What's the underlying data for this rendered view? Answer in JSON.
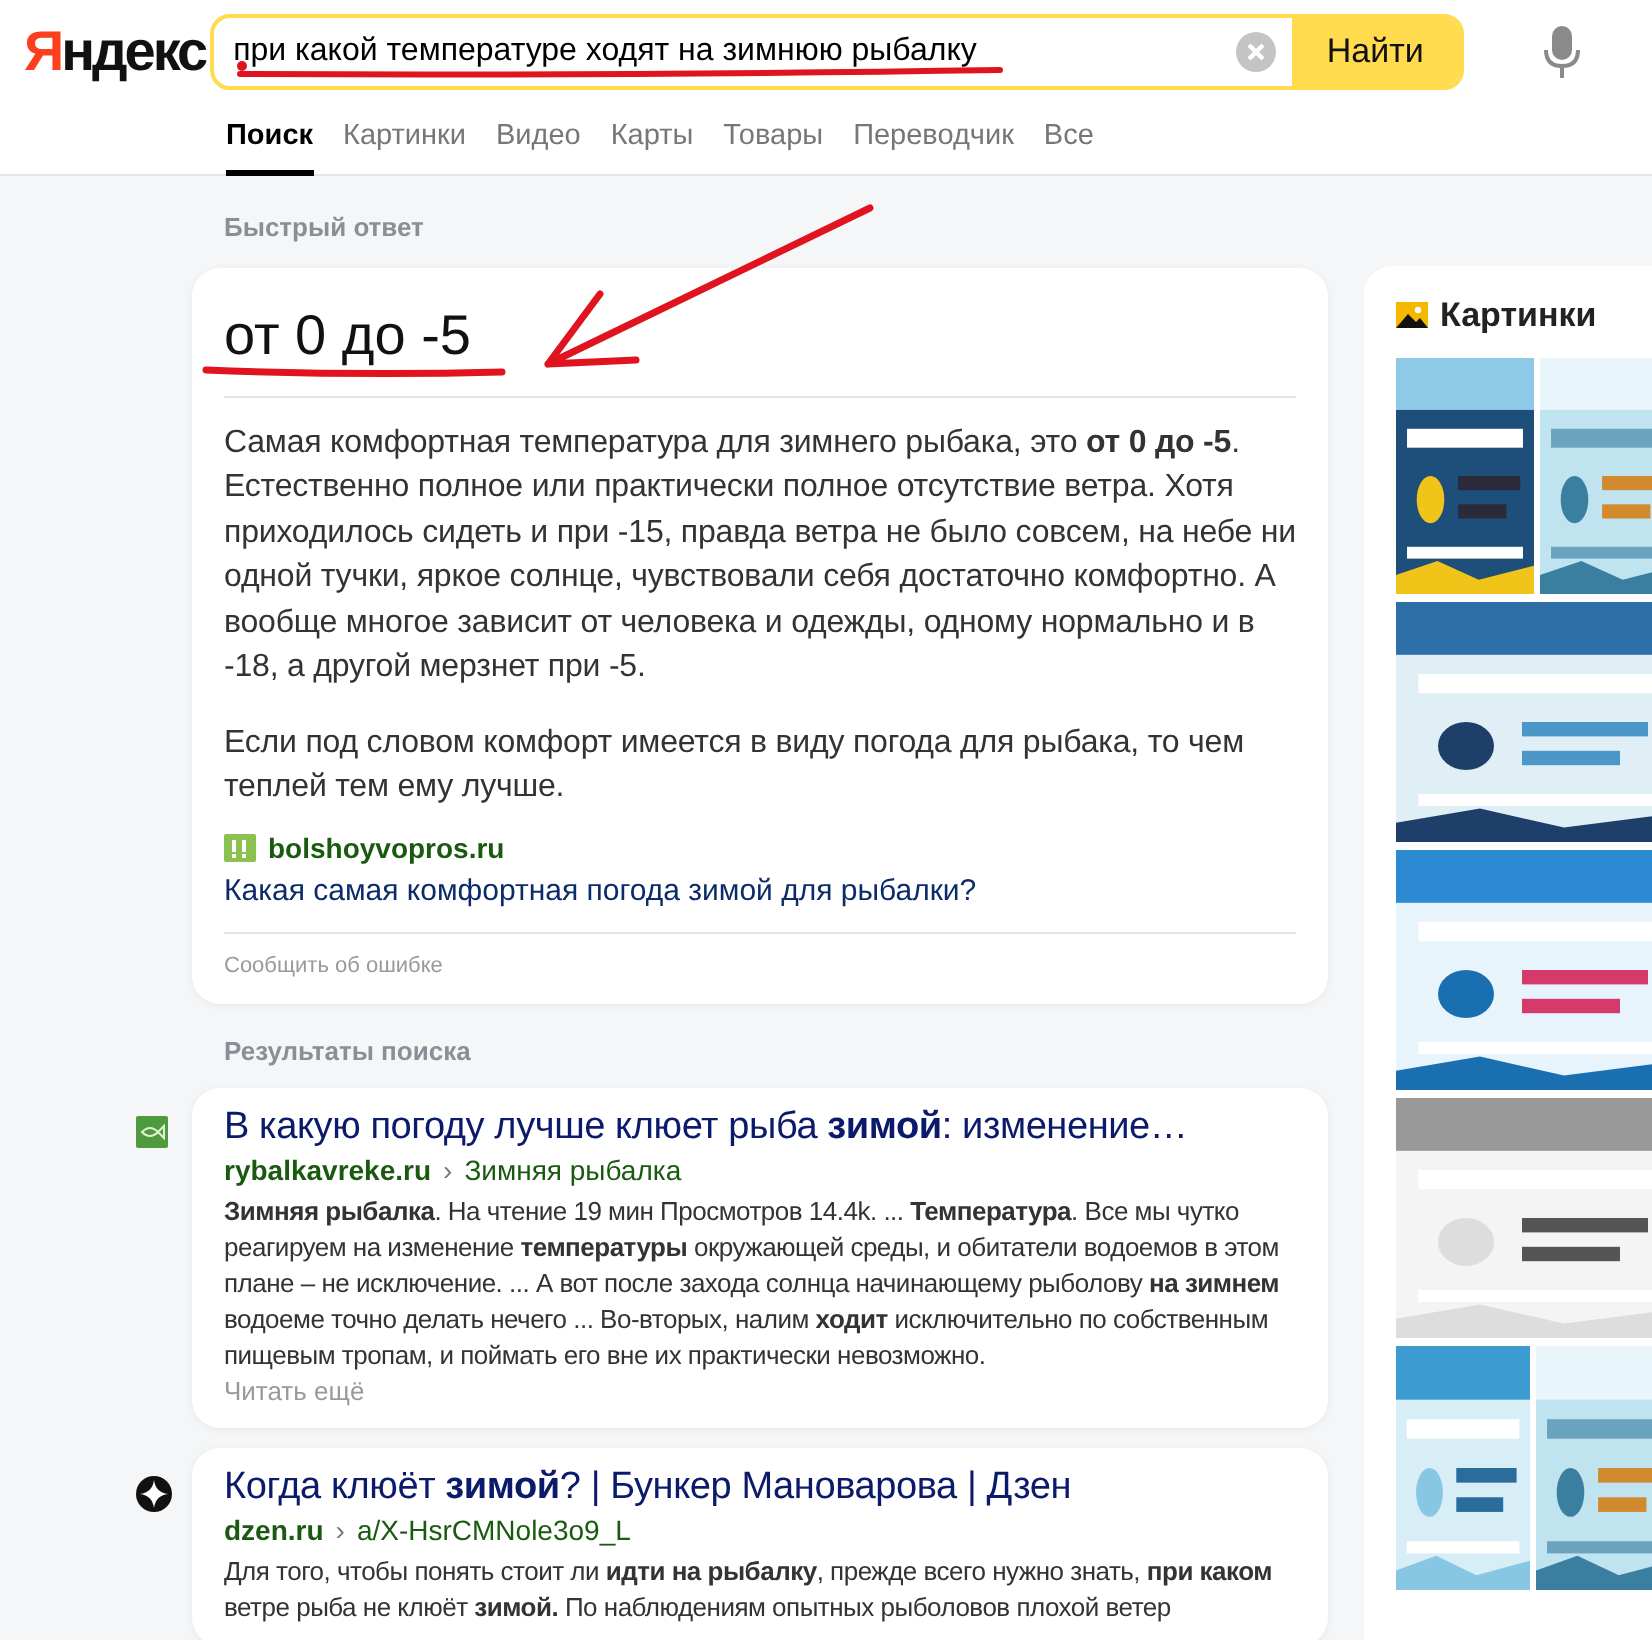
{
  "header": {
    "logo": {
      "first": "Я",
      "rest": "ндекс"
    },
    "search": {
      "value": "при какой температуре ходят на зимнюю рыбалку"
    },
    "search_button": "Найти"
  },
  "tabs": [
    {
      "label": "Поиск",
      "selected": true
    },
    {
      "label": "Картинки",
      "selected": false
    },
    {
      "label": "Видео",
      "selected": false
    },
    {
      "label": "Карты",
      "selected": false
    },
    {
      "label": "Товары",
      "selected": false
    },
    {
      "label": "Переводчик",
      "selected": false
    },
    {
      "label": "Все",
      "selected": false
    }
  ],
  "quick_answer": {
    "label": "Быстрый ответ",
    "title": "от 0 до -5",
    "paragraphs": [
      "Самая комфортная температура для зимнего рыбака, это **от 0 до -5**. Естественно полное или практически полное отсутствие ветра. Хотя приходилось сидеть и при -15, правда ветра не было совсем, на небе ни одной тучки, яркое солнце, чувствовали себя достаточно комфортно. А вообще многое зависит от человека и одежды, одному нормально и в -18, а другой мерзнет при -5.",
      "Если под словом комфорт имеется в виду погода для рыбака, то чем теплей тем ему лучше."
    ],
    "source": "bolshoyvopros.ru",
    "source_link": "Какая самая комфортная погода зимой для рыбалки?",
    "report": "Сообщить об ошибке"
  },
  "results": {
    "label": "Результаты поиска",
    "items": [
      {
        "kind": "fish",
        "title": "В какую погоду лучше клюет рыба **зимой**: изменение…",
        "domain": "rybalkavreke.ru",
        "separator": "›",
        "path": "Зимняя рыбалка",
        "snippet": "**Зимняя рыбалка**. На чтение 19 мин Просмотров 14.4k. ... **Температура**. Все мы чутко реагируем на изменение **температуры** окружающей среды, и обитатели водоемов в этом плане – не исключение. ... А вот после захода солнца начинающему рыболову **на зимнем** водоеме точно делать нечего ... Во-вторых, налим **ходит** исключительно по собственным пищевым тропам, и поймать его вне их практически невозможно.",
        "more": "Читать ещё"
      },
      {
        "kind": "star",
        "title": "Когда клюёт **зимой**? | Бункер Мановарова | Дзен",
        "domain": "dzen.ru",
        "separator": "›",
        "path": "a/X-HsrCMNole3o9_L",
        "snippet": "Для того, чтобы понять стоит ли **идти на рыбалку**, прежде всего нужно знать, **при каком** ветре рыба не клюёт **зимой.** По наблюдениям опытных рыболовов плохой ветер"
      }
    ]
  },
  "images_panel": {
    "title": "Картинки"
  }
}
